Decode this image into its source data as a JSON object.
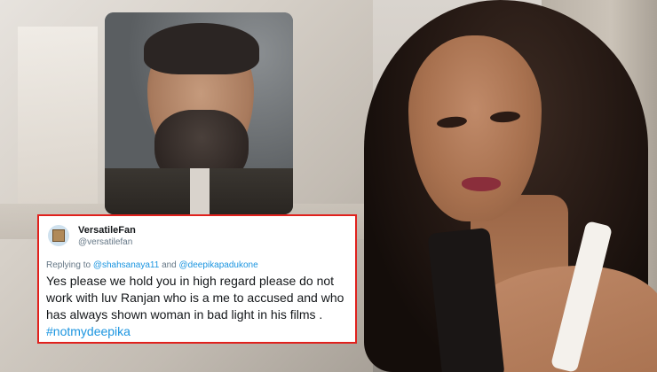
{
  "tweet": {
    "name": "VersatileFan",
    "handle": "@versatilefan",
    "replying_prefix": "Replying to",
    "mention_1": "@shahsanaya11",
    "and_word": "and",
    "mention_2": "@deepikapadukone",
    "body": "Yes please we hold you in high regard please do not work with luv Ranjan who is a me to accused and who has always shown woman in bad light in his films .",
    "hashtag": "#notmydeepika",
    "border_color": "#e0211d",
    "link_color": "#1b95e0"
  }
}
